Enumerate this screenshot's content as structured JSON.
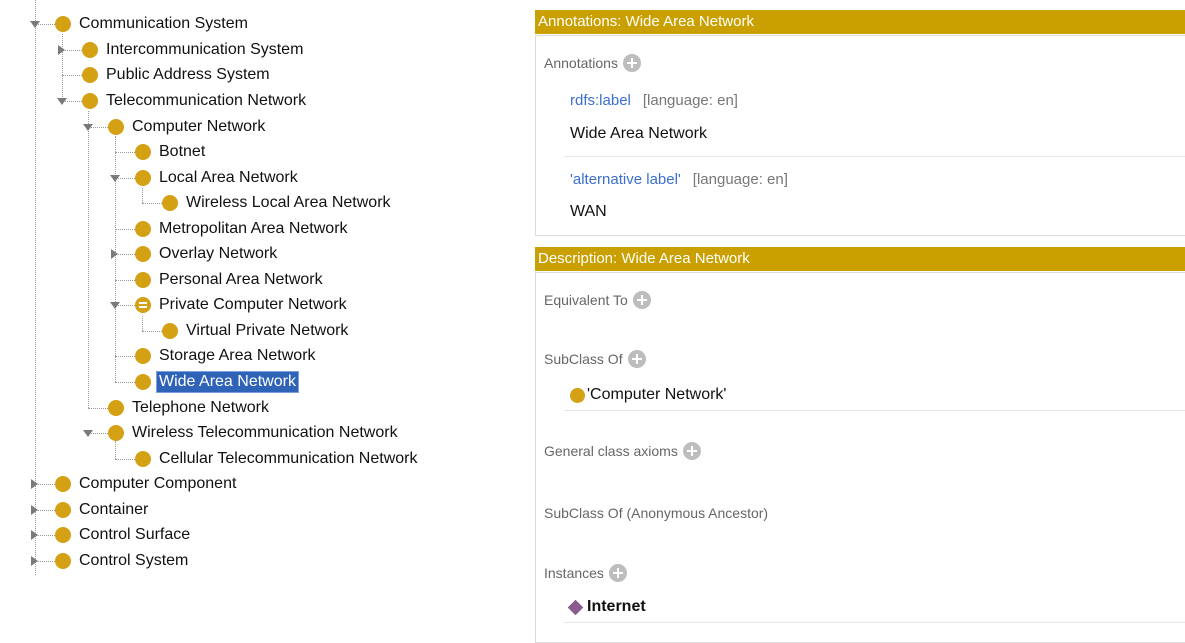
{
  "tree": {
    "communication_system": "Communication System",
    "intercommunication_system": "Intercommunication System",
    "public_address_system": "Public Address System",
    "telecommunication_network": "Telecommunication Network",
    "computer_network": "Computer Network",
    "botnet": "Botnet",
    "local_area_network": "Local Area Network",
    "wireless_local_area_network": "Wireless Local Area Network",
    "metropolitan_area_network": "Metropolitan Area Network",
    "overlay_network": "Overlay Network",
    "personal_area_network": "Personal Area Network",
    "private_computer_network": "Private Computer Network",
    "virtual_private_network": "Virtual Private Network",
    "storage_area_network": "Storage Area Network",
    "wide_area_network": "Wide Area Network",
    "telephone_network": "Telephone Network",
    "wireless_telecommunication_network": "Wireless Telecommunication Network",
    "cellular_telecommunication_network": "Cellular Telecommunication Network",
    "computer_component": "Computer Component",
    "container": "Container",
    "control_surface": "Control Surface",
    "control_system": "Control System"
  },
  "annotations": {
    "header": "Annotations: Wide Area Network",
    "section_label": "Annotations",
    "items": [
      {
        "property": "rdfs:label",
        "language": "[language: en]",
        "value": "Wide Area Network"
      },
      {
        "property": "'alternative label'",
        "language": "[language: en]",
        "value": "WAN"
      }
    ]
  },
  "description": {
    "header": "Description: Wide Area Network",
    "equivalent_to": "Equivalent To",
    "subclass_of": "SubClass Of",
    "subclass_value": "'Computer Network'",
    "general_class_axioms": "General class axioms",
    "subclass_of_anonymous": "SubClass Of (Anonymous Ancestor)",
    "instances": "Instances",
    "instance_value": "Internet"
  },
  "colors": {
    "header_bg": "#c9a000",
    "class_bullet": "#d4a114",
    "individual": "#8b5a8f",
    "selection": "#2f63b8",
    "property_link": "#3a6fd0"
  }
}
